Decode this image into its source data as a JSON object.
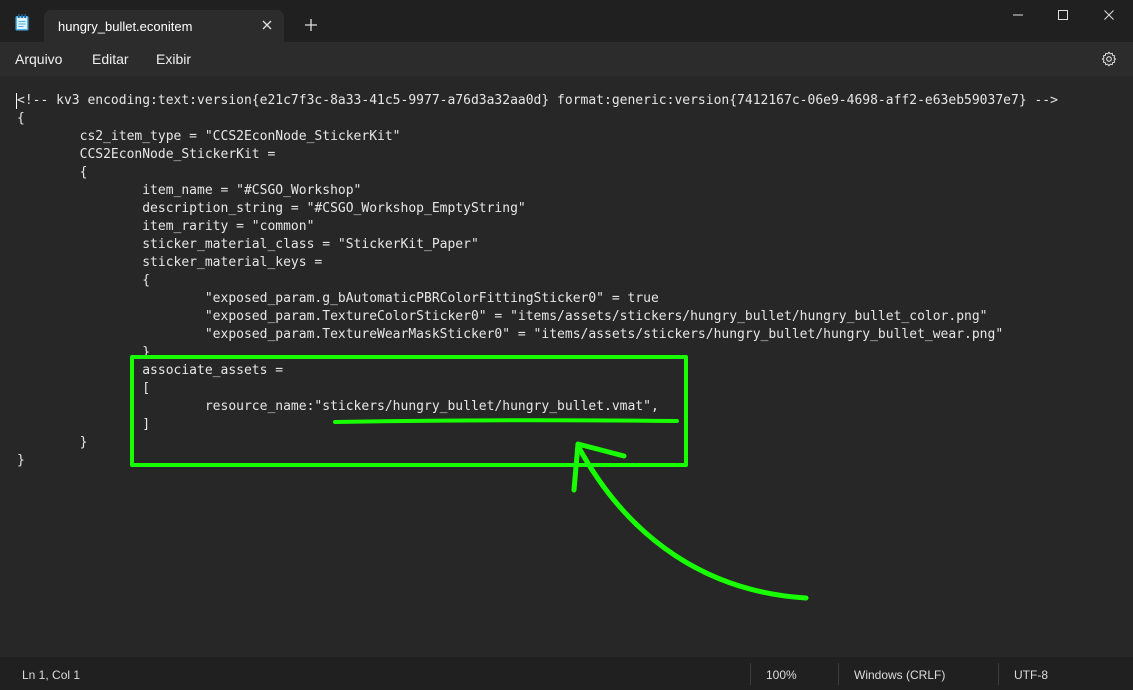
{
  "window": {
    "tab_title": "hungry_bullet.econitem",
    "new_tab_symbol": "+"
  },
  "menu": {
    "items": [
      "Arquivo",
      "Editar",
      "Exibir"
    ],
    "settings_icon": "gear-icon"
  },
  "editor": {
    "lines": [
      "<!-- kv3 encoding:text:version{e21c7f3c-8a33-41c5-9977-a76d3a32aa0d} format:generic:version{7412167c-06e9-4698-aff2-e63eb59037e7} -->",
      "{",
      "\tcs2_item_type = \"CCS2EconNode_StickerKit\"",
      "\tCCS2EconNode_StickerKit =",
      "\t{",
      "\t\titem_name = \"#CSGO_Workshop\"",
      "\t\tdescription_string = \"#CSGO_Workshop_EmptyString\"",
      "\t\titem_rarity = \"common\"",
      "\t\tsticker_material_class = \"StickerKit_Paper\"",
      "\t\tsticker_material_keys =",
      "\t\t{",
      "\t\t\t\"exposed_param.g_bAutomaticPBRColorFittingSticker0\" = true",
      "\t\t\t\"exposed_param.TextureColorSticker0\" = \"items/assets/stickers/hungry_bullet/hungry_bullet_color.png\"",
      "\t\t\t\"exposed_param.TextureWearMaskSticker0\" = \"items/assets/stickers/hungry_bullet/hungry_bullet_wear.png\"",
      "\t\t}",
      "\t\tassociate_assets =",
      "\t\t[",
      "\t\t\tresource_name:\"stickers/hungry_bullet/hungry_bullet.vmat\",",
      "\t\t]",
      "\t}",
      "}"
    ],
    "annotation_color": "#17ff00"
  },
  "status": {
    "position": "Ln 1, Col 1",
    "zoom": "100%",
    "line_ending": "Windows (CRLF)",
    "encoding": "UTF-8"
  }
}
